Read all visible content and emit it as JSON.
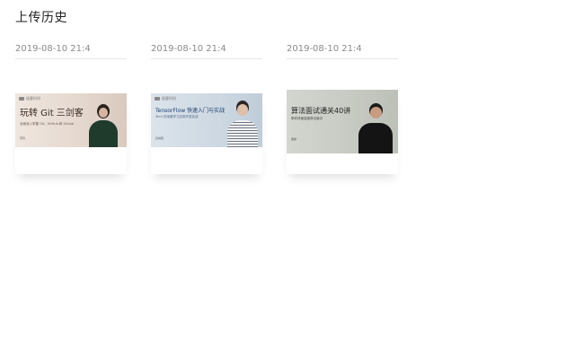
{
  "page": {
    "title": "上传历史"
  },
  "cards": [
    {
      "date": "2019-08-10 21:4",
      "thumbnail": {
        "brand": "极客时间",
        "title": "玩转 Git 三剑客",
        "subtitle": "全面深入掌握 Git、GitHub 和 GitLab",
        "author": "苏玲",
        "background": "#e8ddd6",
        "title_color": "#3a2a24"
      }
    },
    {
      "date": "2019-08-10 21:4",
      "thumbnail": {
        "brand": "极客时间",
        "title": "TensorFlow 快速入门与实战",
        "subtitle": "Tech 的深度学习应用开发实战",
        "author": "彭靖田",
        "background": "#cfd9e3",
        "title_color": "#1c3f6e"
      }
    },
    {
      "date": "2019-08-10 21:4",
      "thumbnail": {
        "brand": "",
        "title": "算法面试通关40讲",
        "subtitle": "带你快速突破算法面试",
        "author": "覃超",
        "background": "#c5cac2",
        "title_color": "#1e1e1e"
      }
    }
  ]
}
